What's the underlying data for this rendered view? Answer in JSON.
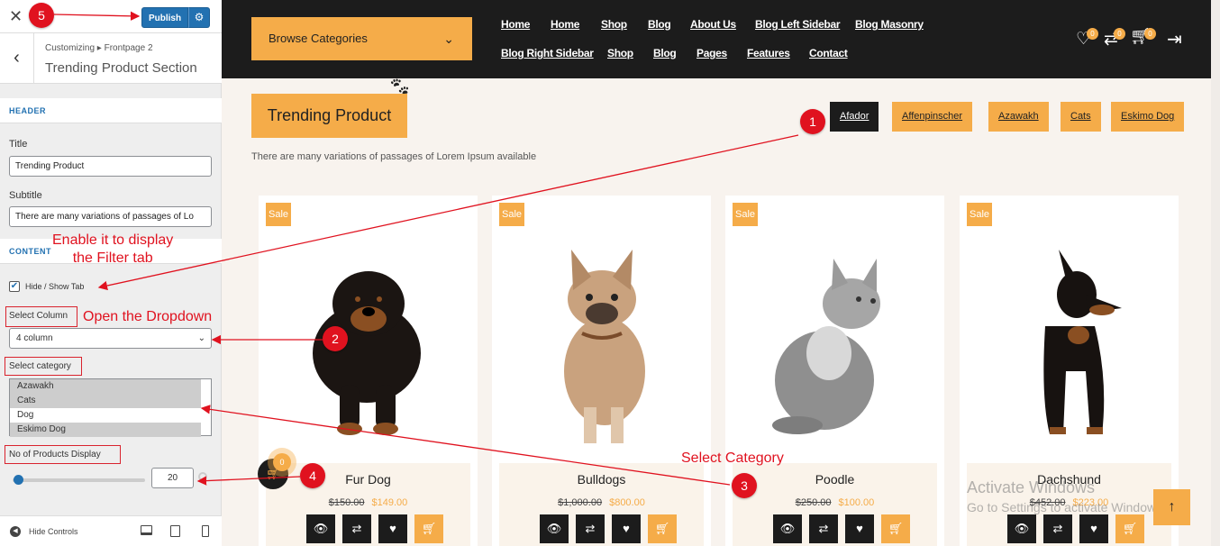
{
  "customizer": {
    "close_icon": "close-icon",
    "publish_label": "Publish",
    "settings_icon": "gear-icon",
    "breadcrumb": "Customizing ▸ Frontpage 2",
    "section_title": "Trending Product Section",
    "header_label": "HEADER",
    "title_label": "Title",
    "title_value": "Trending Product",
    "subtitle_label": "Subtitle",
    "subtitle_value": "There are many variations of passages of Lo",
    "content_label": "CONTENT",
    "hide_show_tab_label": "Hide / Show Tab",
    "hide_show_tab_checked": true,
    "select_column_label": "Select Column",
    "select_column_value": "4 column",
    "select_category_label": "Select category",
    "categories": [
      {
        "label": "Azawakh",
        "selected": true
      },
      {
        "label": "Cats",
        "selected": true
      },
      {
        "label": "Dog",
        "selected": false
      },
      {
        "label": "Eskimo Dog",
        "selected": true
      }
    ],
    "products_display_label": "No of Products Display",
    "products_display_value": "20",
    "hide_controls_label": "Hide Controls"
  },
  "site": {
    "browse_label": "Browse Categories",
    "nav_row1": [
      "Home",
      "Home",
      "Shop",
      "Blog",
      "About Us",
      "Blog Left Sidebar",
      "Blog Masonry"
    ],
    "nav_row2": [
      "Blog Right Sidebar",
      "Shop",
      "Blog",
      "Pages",
      "Features",
      "Contact"
    ],
    "wishlist_count": "0",
    "compare_count": "0",
    "cart_count": "0",
    "section_title": "Trending Product",
    "section_subtitle": "There are many variations of passages of Lorem Ipsum available",
    "filter_tabs": [
      "Afador",
      "Affenpinscher",
      "Azawakh",
      "Cats",
      "Eskimo Dog"
    ],
    "active_tab": "Afador",
    "products": [
      {
        "sale": "Sale",
        "name": "Fur Dog",
        "old_price": "$150.00",
        "new_price": "$149.00"
      },
      {
        "sale": "Sale",
        "name": "Bulldogs",
        "old_price": "$1,000.00",
        "new_price": "$800.00"
      },
      {
        "sale": "Sale",
        "name": "Poodle",
        "old_price": "$250.00",
        "new_price": "$100.00"
      },
      {
        "sale": "Sale",
        "name": "Dachshund",
        "old_price": "$452.00",
        "new_price": "$223.00"
      }
    ],
    "floating_cart_count": "0"
  },
  "watermark": {
    "line1": "Activate Windows",
    "line2": "Go to Settings to activate Windows."
  },
  "annotations": {
    "n1": "1",
    "n2": "2",
    "n3": "3",
    "n4": "4",
    "n5": "5",
    "t1": "Enable it to display\nthe Filter tab",
    "t2": "Open the Dropdown",
    "t3": "Select Category"
  },
  "colors": {
    "accent": "#f5ac49",
    "dark": "#1c1c1c",
    "wp_blue": "#2271b1",
    "annotation_red": "#e0121f"
  }
}
